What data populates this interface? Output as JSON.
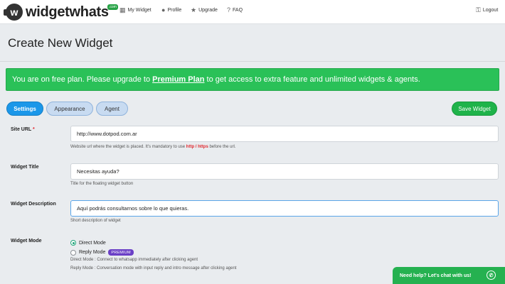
{
  "header": {
    "logo_letter": "w",
    "logo_text": "widgetwhats",
    "logo_badge": ".com",
    "nav": [
      {
        "icon": "grid-icon",
        "label": "My Widget"
      },
      {
        "icon": "user-icon",
        "label": "Profile"
      },
      {
        "icon": "star-icon",
        "label": "Upgrade"
      },
      {
        "icon": "question-icon",
        "label": "FAQ"
      }
    ],
    "logout_label": "Logout"
  },
  "page": {
    "title": "Create New Widget"
  },
  "banner": {
    "text_before": "You are on free plan. Please upgrade to ",
    "link": "Premium Plan",
    "text_after": " to get access to extra feature and unlimited widgets & agents."
  },
  "tabs": [
    {
      "label": "Settings",
      "active": true
    },
    {
      "label": "Appearance",
      "active": false
    },
    {
      "label": "Agent",
      "active": false
    }
  ],
  "save_label": "Save Widget",
  "form": {
    "site_url": {
      "label": "Site URL",
      "required": "*",
      "value": "http://www.dotpod.com.ar",
      "help_before": "Website url where the widget is placed. It's mandatory to use ",
      "help_bold": "http / https",
      "help_after": " before the url."
    },
    "widget_title": {
      "label": "Widget Title",
      "value": "Necesitas ayuda?",
      "help": "Title for the floating widget button"
    },
    "widget_description": {
      "label": "Widget Description",
      "value": "Aquí podrás consultarnos sobre lo que quieras.",
      "help": "Short description of widget"
    },
    "widget_mode": {
      "label": "Widget Mode",
      "options": [
        {
          "label": "Direct Mode",
          "checked": true
        },
        {
          "label": "Reply Mode",
          "checked": false,
          "badge": "PREMIUM"
        }
      ],
      "help_direct": "Direct Mode : Connect to whatsapp immediately after clicking agent",
      "help_reply": "Reply Mode : Conversation mode with input reply and intro message after clicking agent"
    }
  },
  "chat_widget": {
    "label": "Need help? Let's chat with us!"
  },
  "colors": {
    "accent_blue": "#1b97e9",
    "brand_green": "#25b150",
    "premium_purple": "#6a3fc6"
  }
}
